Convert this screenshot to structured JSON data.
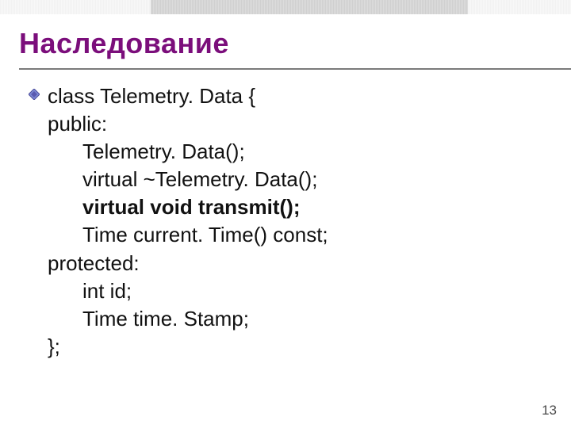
{
  "title": "Наследование",
  "code": {
    "l1": "class Telemetry. Data {",
    "l2": "public:",
    "l3": "Telemetry. Data();",
    "l4": "virtual ~Telemetry. Data();",
    "l5": "virtual void transmit();",
    "l6": "Time current. Time() const;",
    "l7": "protected:",
    "l8": "int id;",
    "l9": "Time time. Stamp;",
    "l10": "};"
  },
  "page_number": "13"
}
